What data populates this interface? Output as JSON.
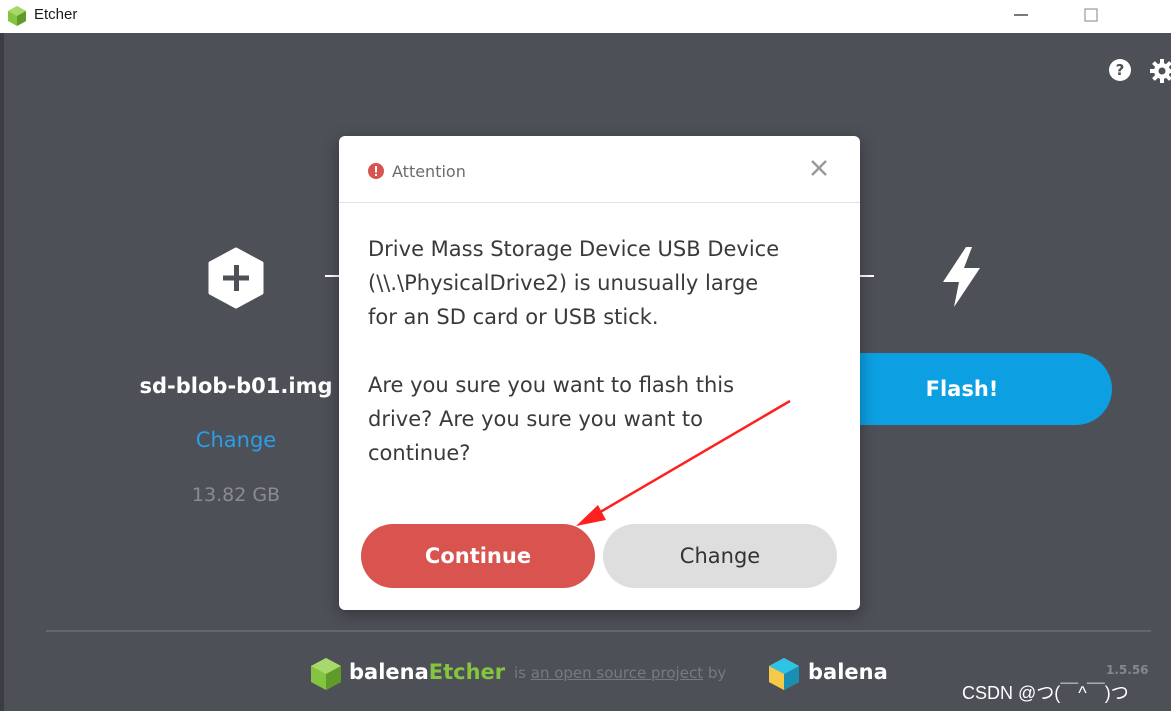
{
  "window": {
    "title": "Etcher"
  },
  "header_icons": {
    "help": "help-icon",
    "settings": "gear-icon"
  },
  "steps": {
    "image": {
      "filename": "sd-blob-b01.img",
      "change_label": "Change",
      "size": "13.82 GB"
    },
    "flash": {
      "label": "Flash!"
    }
  },
  "modal": {
    "title": "Attention",
    "message_lines": [
      "Drive Mass Storage Device USB Device",
      "(\\\\.\\PhysicalDrive2) is unusually large",
      "for an SD card or USB stick."
    ],
    "question_lines": [
      "Are you sure you want to flash this",
      "drive? Are you sure you want to",
      "continue?"
    ],
    "continue_label": "Continue",
    "change_label": "Change"
  },
  "footer": {
    "brand_a": "balena",
    "brand_b": "Etcher",
    "tagline_pre": "is ",
    "tagline_link": "an open source project",
    "tagline_post": " by",
    "company": "balena",
    "version": "1.5.56"
  },
  "watermark": "CSDN @つ(￣^￣)つ",
  "colors": {
    "accent": "#0ca0e3",
    "danger": "#d9534f",
    "etcher_green": "#85c441",
    "background": "#4d5057"
  }
}
